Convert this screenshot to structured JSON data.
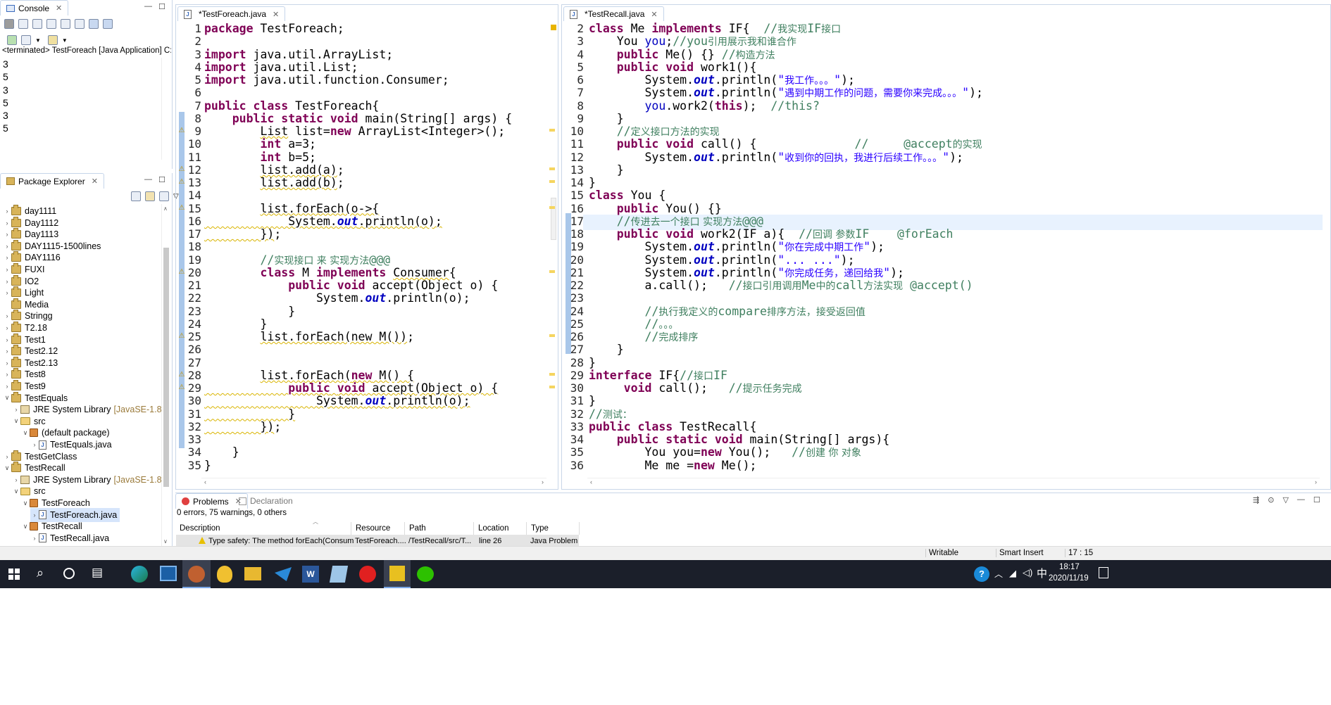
{
  "console": {
    "tab_label": "Console",
    "status_line": "<terminated> TestForeach [Java Application] C:\\P",
    "output": [
      "3",
      "5",
      "3",
      "5",
      "3",
      "5"
    ]
  },
  "package_explorer": {
    "tab_label": "Package Explorer",
    "items": [
      {
        "label": "day1111",
        "type": "project",
        "indent": 0,
        "toggle": ">"
      },
      {
        "label": "Day1112",
        "type": "project",
        "indent": 0,
        "toggle": ">"
      },
      {
        "label": "Day1113",
        "type": "project",
        "indent": 0,
        "toggle": ">"
      },
      {
        "label": "DAY1115-1500lines",
        "type": "project",
        "indent": 0,
        "toggle": ">"
      },
      {
        "label": "DAY1116",
        "type": "project",
        "indent": 0,
        "toggle": ">"
      },
      {
        "label": "FUXI",
        "type": "project",
        "indent": 0,
        "toggle": ">"
      },
      {
        "label": "IO2",
        "type": "project",
        "indent": 0,
        "toggle": ">"
      },
      {
        "label": "Light",
        "type": "project",
        "indent": 0,
        "toggle": ">"
      },
      {
        "label": "Media",
        "type": "project",
        "indent": 0,
        "toggle": ""
      },
      {
        "label": "Stringg",
        "type": "project",
        "indent": 0,
        "toggle": ">"
      },
      {
        "label": "T2.18",
        "type": "project",
        "indent": 0,
        "toggle": ">"
      },
      {
        "label": "Test1",
        "type": "project",
        "indent": 0,
        "toggle": ">"
      },
      {
        "label": "Test2.12",
        "type": "project",
        "indent": 0,
        "toggle": ">"
      },
      {
        "label": "Test2.13",
        "type": "project",
        "indent": 0,
        "toggle": ">"
      },
      {
        "label": "Test8",
        "type": "project",
        "indent": 0,
        "toggle": ">"
      },
      {
        "label": "Test9",
        "type": "project",
        "indent": 0,
        "toggle": ">"
      },
      {
        "label": "TestEquals",
        "type": "project",
        "indent": 0,
        "toggle": "v"
      },
      {
        "label": "JRE System Library",
        "suffix": "[JavaSE-1.8]",
        "type": "lib",
        "indent": 1,
        "toggle": ">"
      },
      {
        "label": "src",
        "type": "src",
        "indent": 1,
        "toggle": "v"
      },
      {
        "label": "(default package)",
        "type": "pkg",
        "indent": 2,
        "toggle": "v"
      },
      {
        "label": "TestEquals.java",
        "type": "java",
        "indent": 3,
        "toggle": ">"
      },
      {
        "label": "TestGetClass",
        "type": "project",
        "indent": 0,
        "toggle": ">"
      },
      {
        "label": "TestRecall",
        "type": "project",
        "indent": 0,
        "toggle": "v"
      },
      {
        "label": "JRE System Library",
        "suffix": "[JavaSE-1.8]",
        "type": "lib",
        "indent": 1,
        "toggle": ">"
      },
      {
        "label": "src",
        "type": "src",
        "indent": 1,
        "toggle": "v"
      },
      {
        "label": "TestForeach",
        "type": "pkg",
        "indent": 2,
        "toggle": "v"
      },
      {
        "label": "TestForeach.java",
        "type": "java",
        "indent": 3,
        "toggle": ">",
        "selected": true
      },
      {
        "label": "TestRecall",
        "type": "pkg",
        "indent": 2,
        "toggle": "v"
      },
      {
        "label": "TestRecall.java",
        "type": "java",
        "indent": 3,
        "toggle": ">"
      }
    ]
  },
  "editor_left": {
    "tab_label": "*TestForeach.java",
    "line_numbers": [
      "1",
      "2",
      "3",
      "4",
      "5",
      "6",
      "7",
      "8",
      "9",
      "10",
      "11",
      "12",
      "13",
      "14",
      "15",
      "16",
      "17",
      "18",
      "19",
      "20",
      "21",
      "22",
      "23",
      "24",
      "25",
      "26",
      "27",
      "28",
      "29",
      "30",
      "31",
      "32",
      "33",
      "34",
      "35"
    ]
  },
  "editor_right": {
    "tab_label": "*TestRecall.java",
    "line_numbers": [
      "2",
      "3",
      "4",
      "5",
      "6",
      "7",
      "8",
      "9",
      "10",
      "11",
      "12",
      "13",
      "14",
      "15",
      "16",
      "17",
      "18",
      "19",
      "20",
      "21",
      "22",
      "23",
      "24",
      "25",
      "26",
      "27",
      "28",
      "29",
      "30",
      "31",
      "32",
      "33",
      "34",
      "35",
      "36"
    ]
  },
  "bottom_panel": {
    "tabs": {
      "problems": "Problems",
      "declaration": "Declaration"
    },
    "summary": "0 errors, 75 warnings, 0 others",
    "columns": {
      "description": "Description",
      "resource": "Resource",
      "path": "Path",
      "location": "Location",
      "type": "Type"
    },
    "row": {
      "description": "Type safety: The method forEach(Consum",
      "resource": "TestForeach....",
      "path": "/TestRecall/src/T...",
      "location": "line 26",
      "type": "Java Problem"
    }
  },
  "status_bar": {
    "writable": "Writable",
    "insert_mode": "Smart Insert",
    "position": "17 : 15"
  },
  "taskbar": {
    "time": "18:17",
    "date": "2020/11/19",
    "ime": "中",
    "help": "?"
  },
  "colors": {
    "keyword": "#7f0055",
    "comment": "#3f7f5f",
    "string": "#2a00ff",
    "field": "#0000c0",
    "taskbar": "#1b1f2a",
    "selection": "#d6e5fb"
  }
}
